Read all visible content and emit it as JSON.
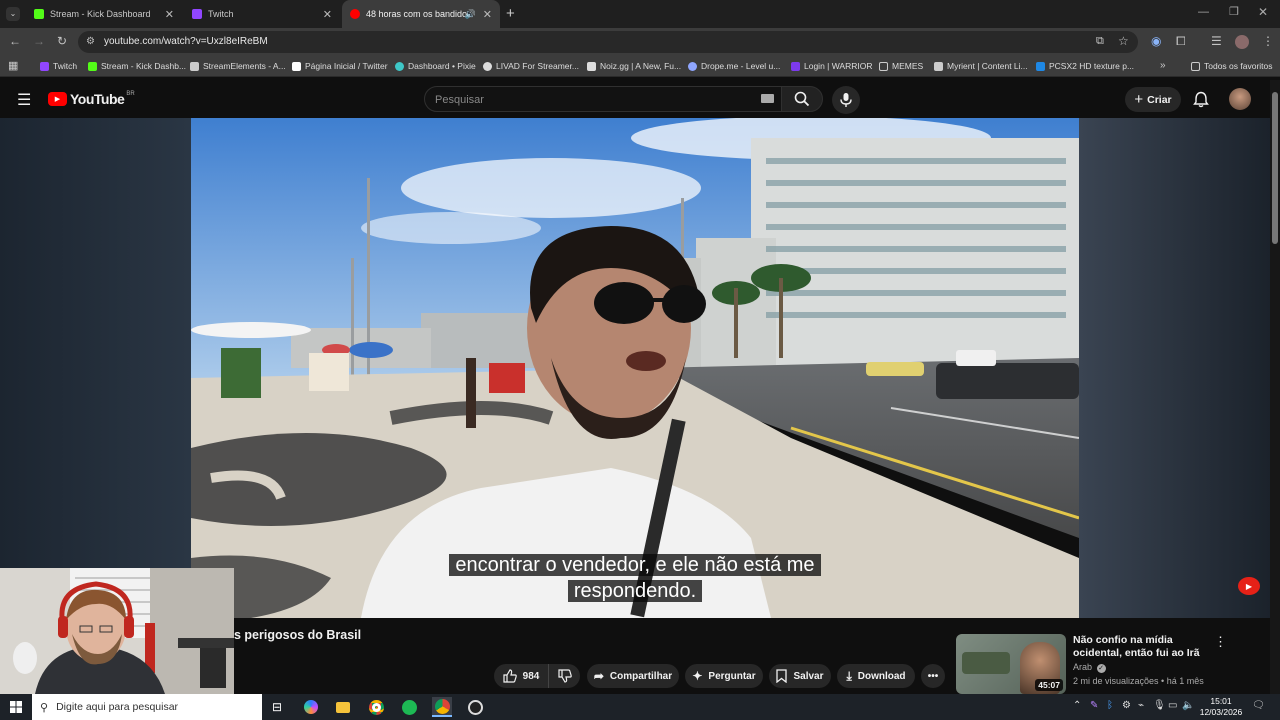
{
  "browser": {
    "tabs": [
      {
        "title": "Stream - Kick Dashboard",
        "color": "#53fc18"
      },
      {
        "title": "Twitch",
        "color": "#9146ff"
      },
      {
        "title": "48 horas com os bandidos",
        "color": "#ff0000"
      }
    ],
    "url": "youtube.com/watch?v=Uxzl8eIReBM",
    "bookmarks": [
      {
        "label": "Twitch",
        "color": "#9146ff"
      },
      {
        "label": "Stream - Kick Dashb...",
        "color": "#53fc18"
      },
      {
        "label": "StreamElements - A...",
        "color": "#cccccc"
      },
      {
        "label": "Página Inicial / Twitter",
        "color": "#ffffff"
      },
      {
        "label": "Dashboard • Pixie",
        "color": "#3ec7c7"
      },
      {
        "label": "LIVAD For Streamer...",
        "color": "#dddddd"
      },
      {
        "label": "Noiz.gg | A New, Fu...",
        "color": "#dddddd"
      },
      {
        "label": "Drope.me - Level u...",
        "color": "#8fa6ff"
      },
      {
        "label": "Login | WARRIOR",
        "color": "#7c3aed"
      },
      {
        "label": "MEMES",
        "color": "#cccccc"
      },
      {
        "label": "Myrient | Content Li...",
        "color": "#cccccc"
      },
      {
        "label": "PCSX2 HD texture p...",
        "color": "#1e88e5"
      }
    ],
    "all_favorites": "Todos os favoritos"
  },
  "youtube": {
    "logo": "YouTube",
    "region": "BR",
    "search_placeholder": "Pesquisar",
    "create_label": "Criar"
  },
  "video": {
    "subtitle_line1": "encontrar o vendedor, e ele não está me",
    "subtitle_line2": "respondendo.",
    "title_partial": "s perigosos do Brasil",
    "likes": "984",
    "share_label": "Compartilhar",
    "ask_label": "Perguntar",
    "save_label": "Salvar",
    "download_label": "Download"
  },
  "recommendation": {
    "title": "Não confio na mídia ocidental, então fui ao Irã",
    "channel": "Arab",
    "meta": "2 mi de visualizações • há 1 mês",
    "duration": "45:07"
  },
  "taskbar": {
    "search_placeholder": "Digite aqui para pesquisar",
    "time": "15:01",
    "date": "12/03/2026"
  }
}
